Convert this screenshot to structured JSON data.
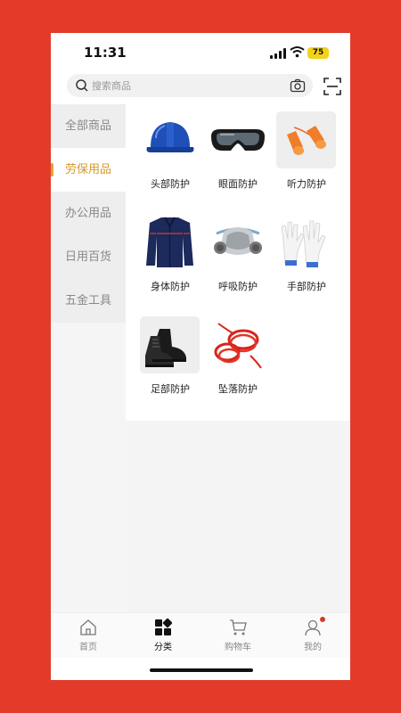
{
  "status_bar": {
    "time": "11:31",
    "battery": "75"
  },
  "search": {
    "placeholder": "搜索商品"
  },
  "sidebar": {
    "items": [
      {
        "label": "全部商品",
        "active": false
      },
      {
        "label": "劳保用品",
        "active": true
      },
      {
        "label": "办公用品",
        "active": false
      },
      {
        "label": "日用百货",
        "active": false
      },
      {
        "label": "五金工具",
        "active": false
      }
    ]
  },
  "grid": {
    "items": [
      {
        "label": "头部防护"
      },
      {
        "label": "眼面防护"
      },
      {
        "label": "听力防护"
      },
      {
        "label": "身体防护"
      },
      {
        "label": "呼吸防护"
      },
      {
        "label": "手部防护"
      },
      {
        "label": "足部防护"
      },
      {
        "label": "坠落防护"
      }
    ]
  },
  "tabbar": {
    "items": [
      {
        "label": "首页"
      },
      {
        "label": "分类"
      },
      {
        "label": "购物车"
      },
      {
        "label": "我的"
      }
    ]
  },
  "colors": {
    "background": "#e23b2a",
    "accent": "#d59a2b",
    "badge": "#d93a2b"
  }
}
